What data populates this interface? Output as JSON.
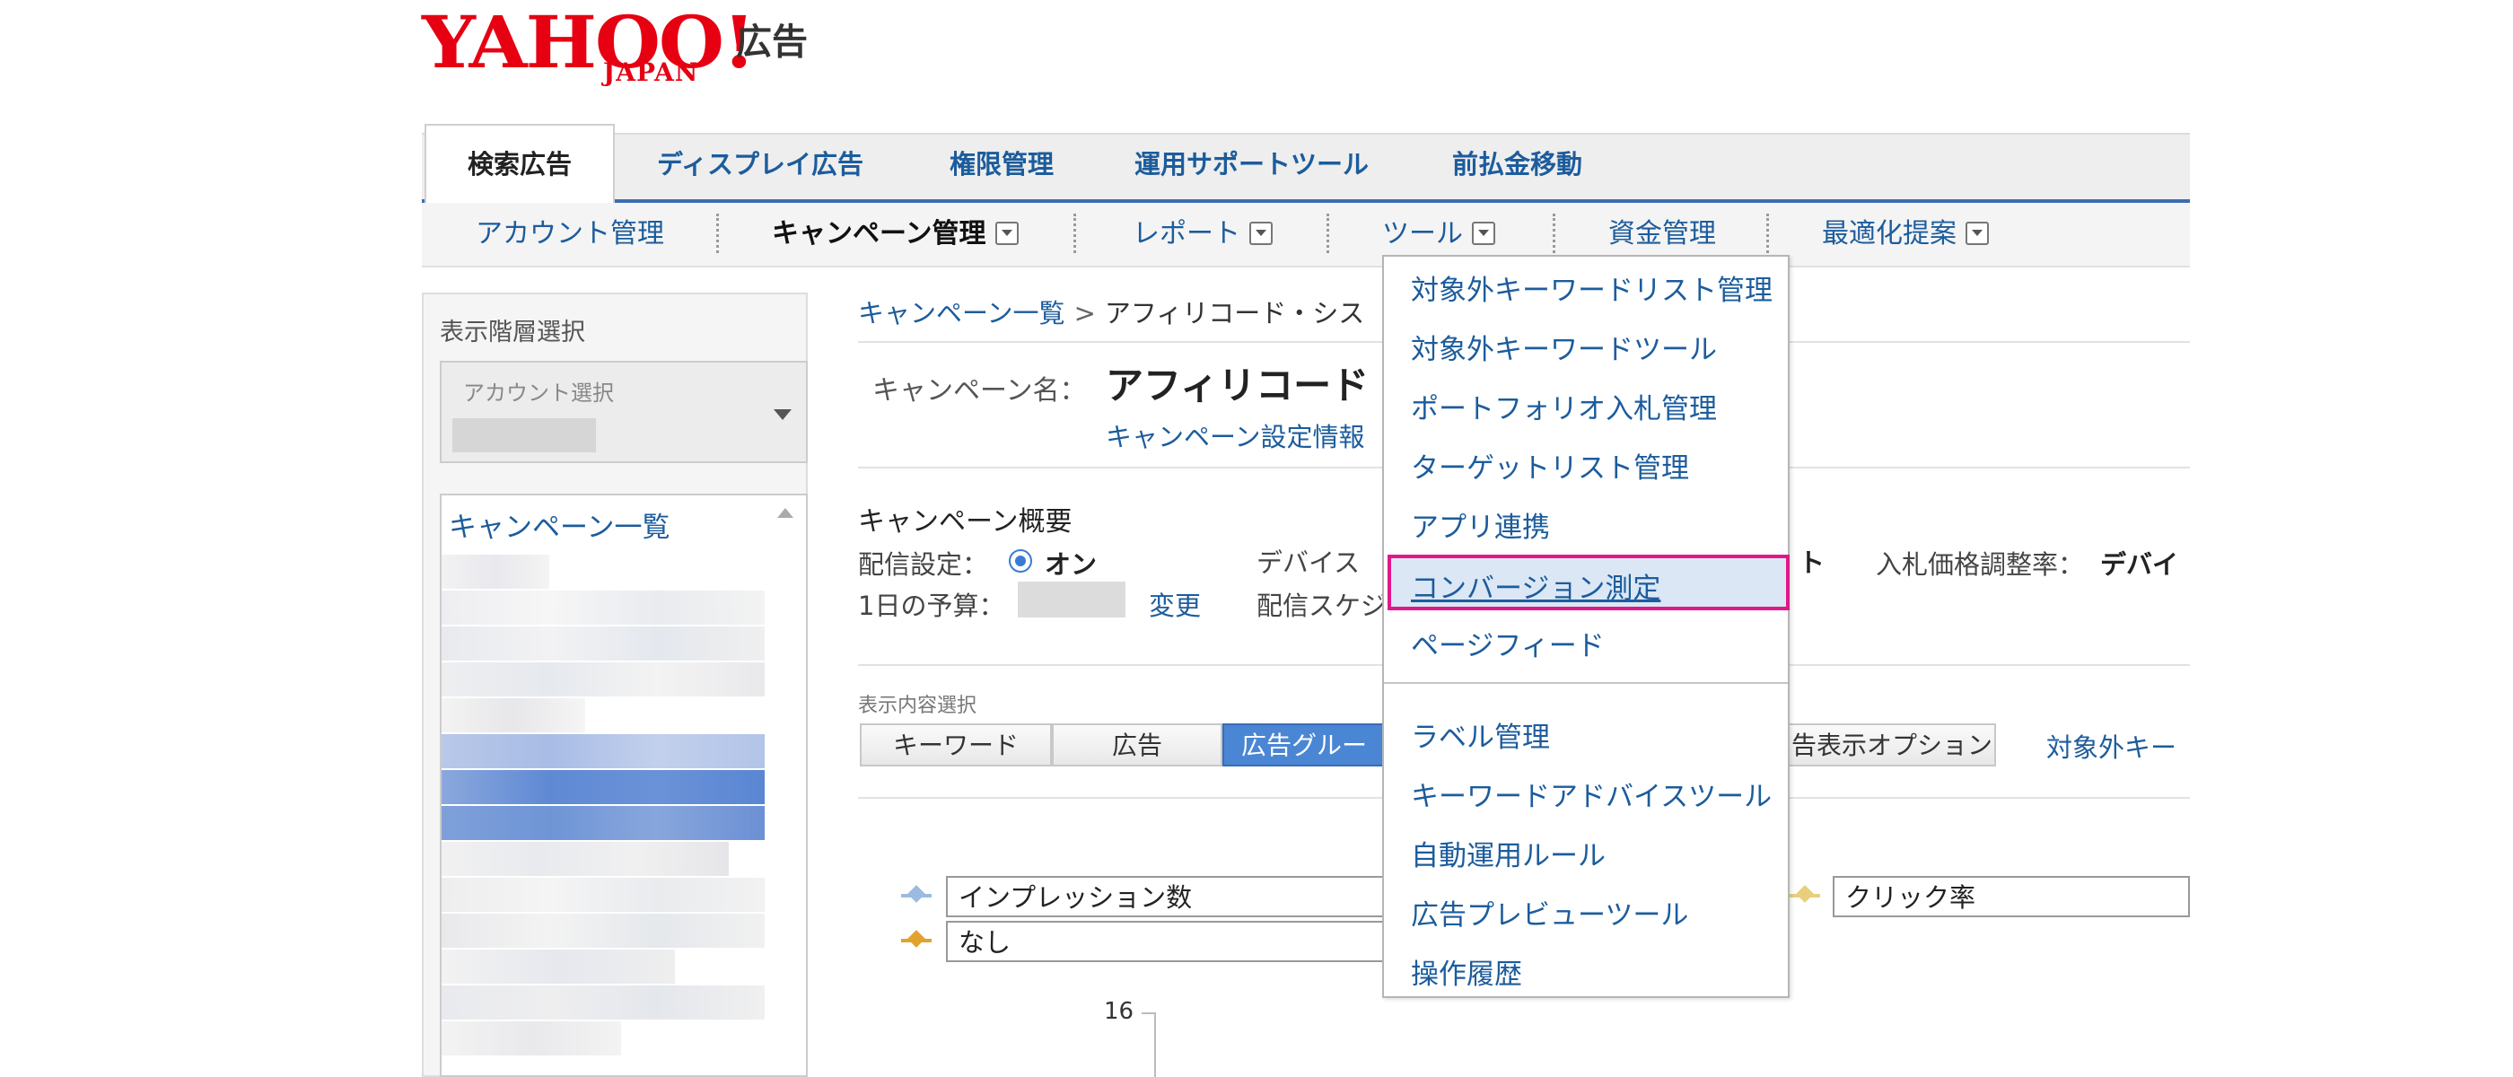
{
  "logo": {
    "brand": "YAHOO!",
    "sub": "JAPAN",
    "suffix": "広告"
  },
  "tabs": {
    "active": "検索広告",
    "items": [
      "ディスプレイ広告",
      "権限管理",
      "運用サポートツール",
      "前払金移動"
    ]
  },
  "subnav": {
    "items": [
      "アカウント管理",
      "キャンペーン管理",
      "レポート",
      "ツール",
      "資金管理",
      "最適化提案"
    ]
  },
  "sidebar": {
    "title": "表示階層選択",
    "account_label": "アカウント選択",
    "campaign_list_label": "キャンペーン一覧"
  },
  "breadcrumb": {
    "root": "キャンペーン一覧",
    "separator": ">",
    "current": "アフィリコード・シス"
  },
  "campaign": {
    "name_label": "キャンペーン名：",
    "name_value": "アフィリコード",
    "settings_link": "キャンペーン設定情報"
  },
  "overview": {
    "title": "キャンペーン概要",
    "delivery_label": "配信設定：",
    "delivery_value": "オン",
    "device_label": "デバイス",
    "device_suffix": "ト",
    "bid_label": "入札価格調整率：",
    "bid_value": "デバイ",
    "budget_label": "1日の予算：",
    "budget_change": "変更",
    "schedule_label": "配信スケジ"
  },
  "view": {
    "label": "表示内容選択",
    "buttons": [
      "キーワード",
      "広告",
      "広告グルー",
      "告表示オプション"
    ],
    "active_button": "広告グルー",
    "extra_link": "対象外キー"
  },
  "chart": {
    "metric1": "インプレッション数",
    "metric2": "なし",
    "metric3": "クリック率",
    "y_tick": "16"
  },
  "dropdown": {
    "items_top": [
      "対象外キーワードリスト管理",
      "対象外キーワードツール",
      "ポートフォリオ入札管理",
      "ターゲットリスト管理",
      "アプリ連携",
      "コンバージョン測定",
      "ページフィード"
    ],
    "items_bottom": [
      "ラベル管理",
      "キーワードアドバイスツール",
      "自動運用ルール",
      "広告プレビューツール",
      "操作履歴"
    ],
    "highlighted": "コンバージョン測定"
  },
  "colors": {
    "brand_red": "#e60012",
    "link_blue": "#1c5c9c",
    "tab_line": "#3b6cb4",
    "highlight_border": "#e0188a",
    "highlight_fill": "#dbe7f5",
    "legend_blue": "#9bbce0",
    "legend_gold": "#e0a32e",
    "legend_yellow": "#e8cf7a"
  }
}
